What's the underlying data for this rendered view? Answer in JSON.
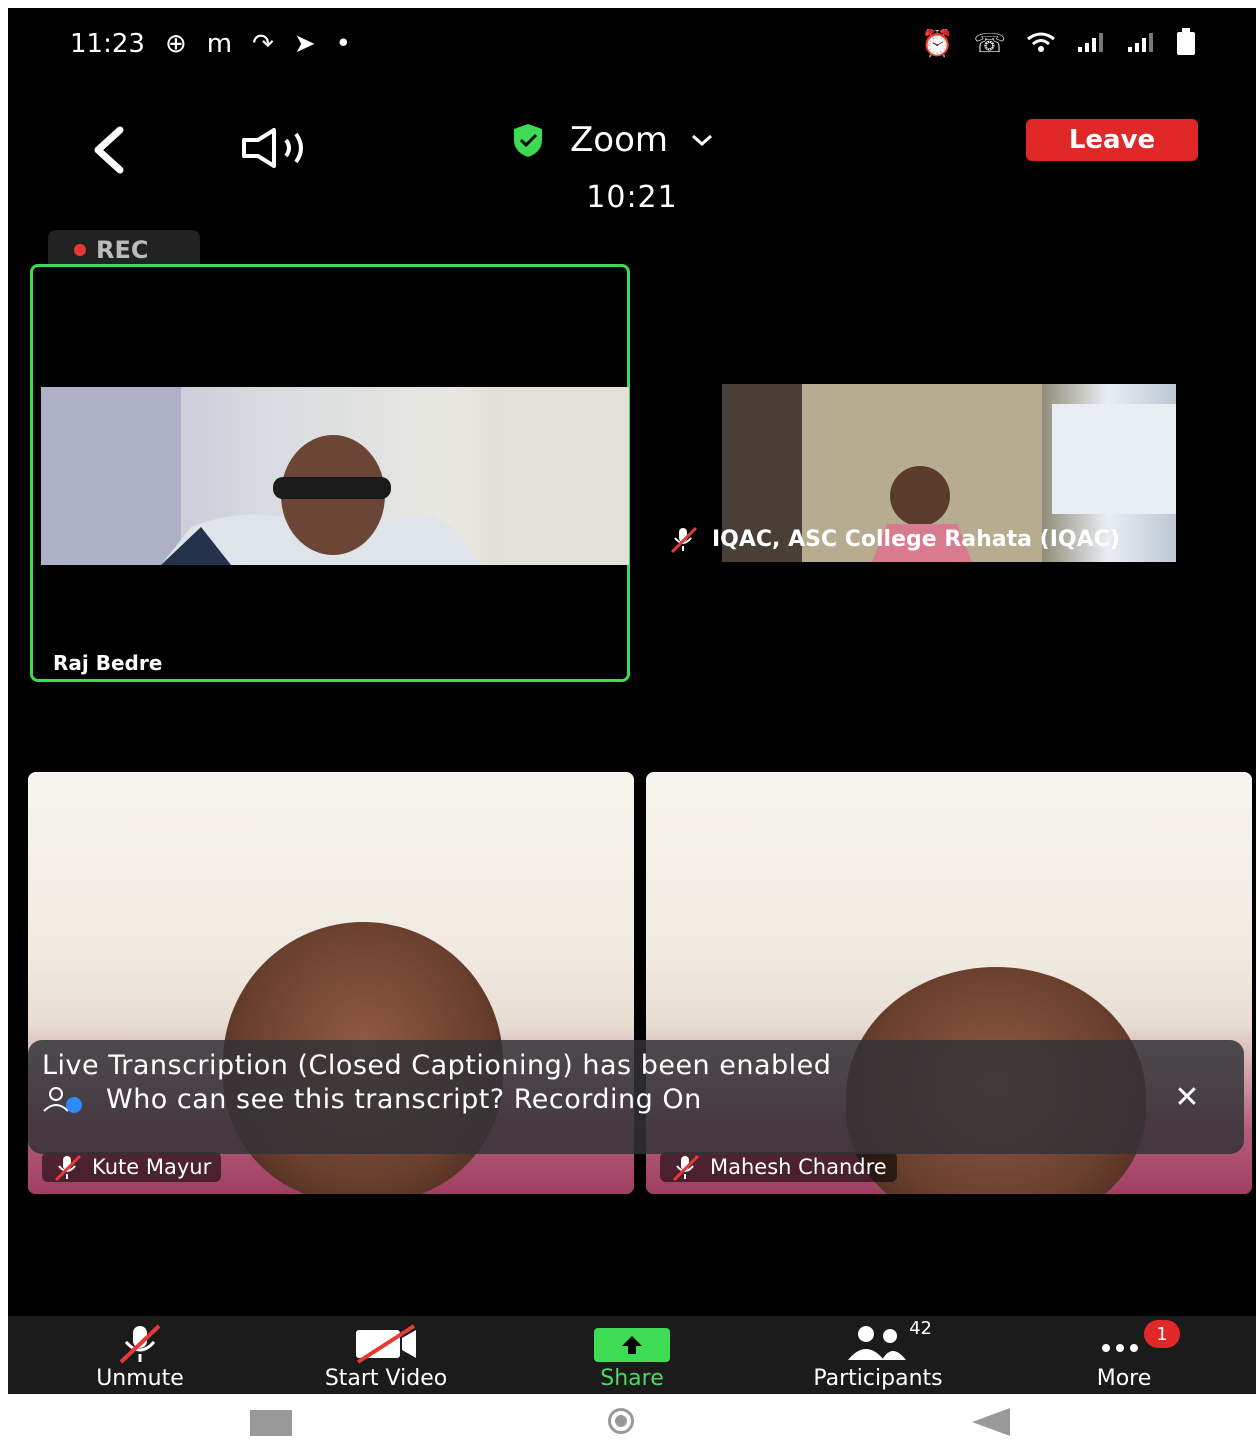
{
  "status_bar": {
    "time": "11:23",
    "left_icons": [
      "grid-app-icon",
      "m-app-icon",
      "missed-call-icon",
      "telegram-icon",
      "dot-icon"
    ],
    "right_icons": [
      "alarm-icon",
      "wifi-call-icon",
      "wifi-icon",
      "signal-1-icon",
      "signal-2-icon",
      "battery-icon"
    ]
  },
  "header": {
    "title": "Zoom",
    "leave_label": "Leave",
    "timer": "10:21"
  },
  "recording": {
    "label": "REC"
  },
  "participants": [
    {
      "name": "Raj Bedre",
      "muted": false,
      "active_speaker": true
    },
    {
      "name": "IQAC, ASC College Rahata (IQAC)",
      "muted": true
    },
    {
      "name": "Kute Mayur",
      "muted": true
    },
    {
      "name": "Mahesh Chandre",
      "muted": true
    }
  ],
  "caption_banner": {
    "line1": "Live Transcription (Closed Captioning) has been enabled",
    "line2": "Who can see this transcript? Recording On"
  },
  "toolbar": {
    "items": [
      {
        "label": "Unmute"
      },
      {
        "label": "Start Video"
      },
      {
        "label": "Share"
      },
      {
        "label": "Participants",
        "count": "42"
      },
      {
        "label": "More",
        "badge": "1"
      }
    ]
  },
  "colors": {
    "leave": "#e02828",
    "active_border": "#3ddc54",
    "share": "#4cd964",
    "badge": "#e02828"
  }
}
